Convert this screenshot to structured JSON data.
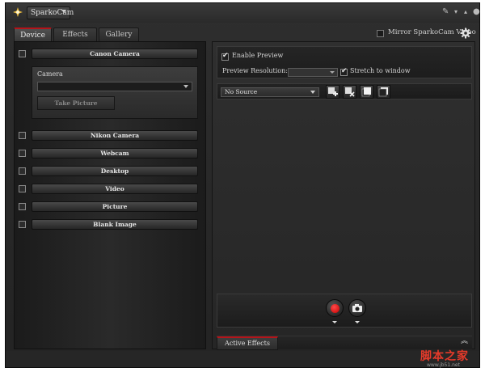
{
  "app": {
    "title": "SparkoCam"
  },
  "tabs": [
    {
      "label": "Device",
      "active": true
    },
    {
      "label": "Effects",
      "active": false
    },
    {
      "label": "Gallery",
      "active": false
    }
  ],
  "mirror": {
    "label": "Mirror SparkoCam Video",
    "checked": false
  },
  "sources": {
    "canon": {
      "label": "Canon Camera",
      "checked": false
    },
    "camera_sub": {
      "label": "Camera",
      "selected": "",
      "take_picture": "Take Picture"
    },
    "list": [
      {
        "label": "Nikon Camera",
        "checked": false
      },
      {
        "label": "Webcam",
        "checked": false
      },
      {
        "label": "Desktop",
        "checked": false
      },
      {
        "label": "Video",
        "checked": false
      },
      {
        "label": "Picture",
        "checked": false
      },
      {
        "label": "Blank Image",
        "checked": false
      }
    ]
  },
  "preview": {
    "enable_label": "Enable Preview",
    "enable_checked": true,
    "resolution_label": "Preview Resolution:",
    "resolution_value": "",
    "stretch_label": "Stretch to window",
    "stretch_checked": true
  },
  "source_select": {
    "value": "No Source"
  },
  "effects_tab": {
    "label": "Active Effects"
  },
  "watermark": {
    "main": "脚本之家",
    "sub": "www.jb51.net"
  },
  "colors": {
    "accent": "#b4141a",
    "record": "#d40000"
  }
}
